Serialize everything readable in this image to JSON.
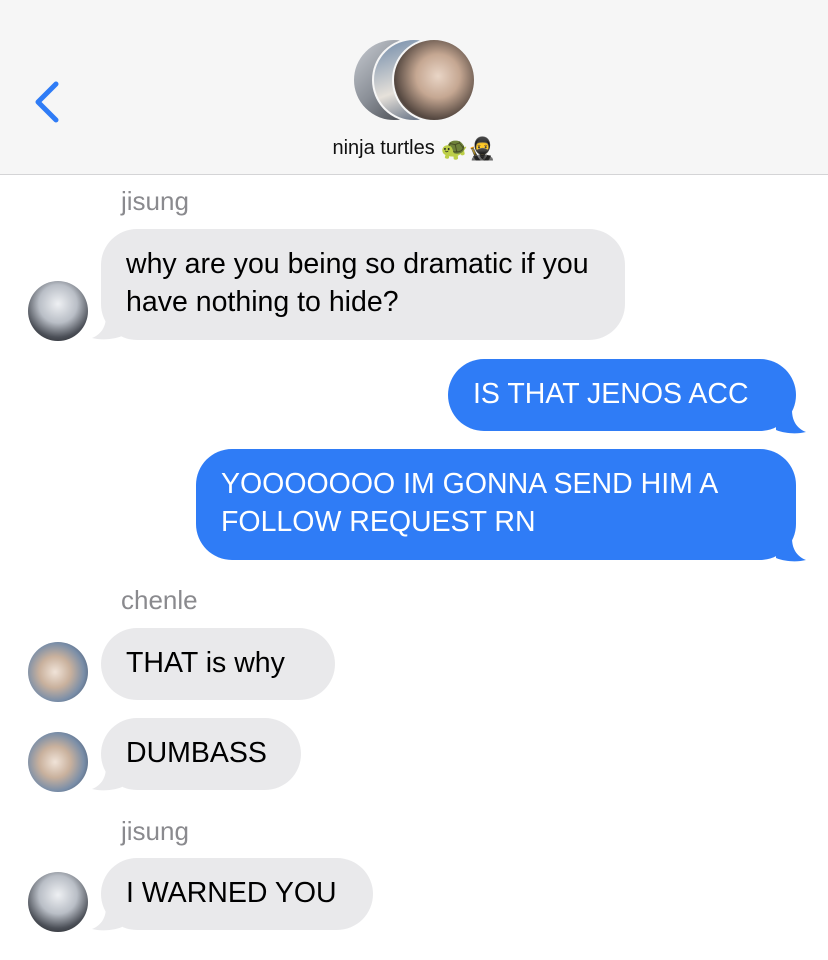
{
  "header": {
    "group_name": "ninja turtles",
    "title_emoji": "🐢🥷"
  },
  "messages": [
    {
      "type": "sender",
      "text": "jisung"
    },
    {
      "type": "in",
      "sender": "jisung",
      "text": "why are you being so dramatic if you have nothing to hide?"
    },
    {
      "type": "out",
      "text": "IS THAT JENOS ACC"
    },
    {
      "type": "out",
      "text": "YOOOOOOO IM GONNA SEND HIM A FOLLOW REQUEST RN"
    },
    {
      "type": "sender",
      "text": "chenle"
    },
    {
      "type": "in",
      "sender": "chenle",
      "text": "THAT is why"
    },
    {
      "type": "in",
      "sender": "chenle",
      "text": "DUMBASS"
    },
    {
      "type": "sender",
      "text": "jisung"
    },
    {
      "type": "in",
      "sender": "jisung",
      "text": "I WARNED YOU"
    }
  ],
  "colors": {
    "outgoing_bubble": "#2f7cf6",
    "incoming_bubble": "#e9e9eb",
    "accent": "#2f7cf6"
  },
  "icons": {
    "back": "chevron-left-icon"
  }
}
